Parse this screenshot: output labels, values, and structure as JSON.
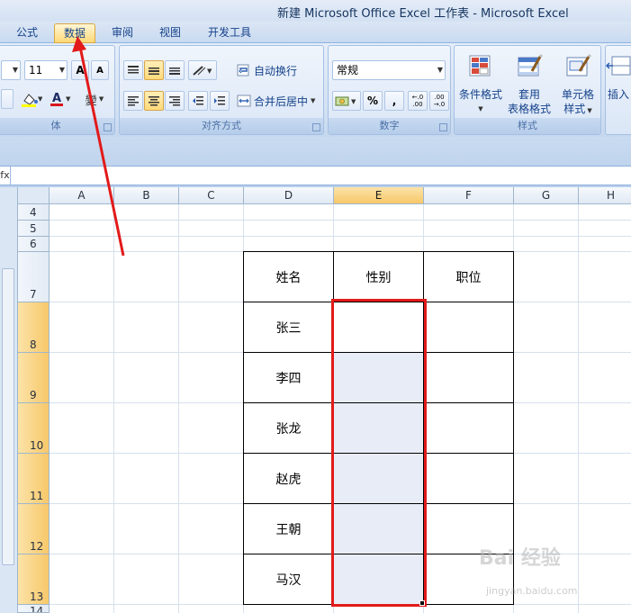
{
  "window": {
    "title": "新建 Microsoft Office Excel 工作表 - Microsoft Excel"
  },
  "tabs": [
    {
      "label": "公式",
      "active": false
    },
    {
      "label": "数据",
      "active": true
    },
    {
      "label": "审阅",
      "active": false
    },
    {
      "label": "视图",
      "active": false
    },
    {
      "label": "开发工具",
      "active": false
    }
  ],
  "ribbon": {
    "font": {
      "size": "11",
      "grow_label": "A",
      "shrink_label": "A",
      "font_color_label": "A",
      "phonetic_label": "變",
      "group_label": "体"
    },
    "alignment": {
      "wrap_text": "自动换行",
      "merge_center": "合并后居中",
      "group_label": "对齐方式"
    },
    "number": {
      "format": "常规",
      "percent": "%",
      "comma": ",",
      "dec_inc": "←.0 .00",
      "dec_dec": ".00 →.0",
      "group_label": "数字"
    },
    "styles": {
      "conditional": "条件格式",
      "table_line1": "套用",
      "table_line2": "表格格式",
      "cell_line1": "单元格",
      "cell_line2": "样式",
      "group_label": "样式"
    },
    "cells": {
      "insert": "插入"
    }
  },
  "formula_bar": {
    "fx": "fx",
    "value": ""
  },
  "sheet": {
    "columns": [
      "A",
      "B",
      "C",
      "D",
      "E",
      "F",
      "G",
      "H"
    ],
    "rows": [
      "4",
      "5",
      "6",
      "7",
      "8",
      "9",
      "10",
      "11",
      "12",
      "13",
      "14"
    ],
    "header": {
      "name": "姓名",
      "gender": "性别",
      "position": "职位"
    },
    "names": [
      "张三",
      "李四",
      "张龙",
      "赵虎",
      "王朝",
      "马汉"
    ]
  },
  "colors": {
    "accent": "#e21a1a",
    "selection_fill": "#e8ecf6",
    "header_highlight": "#f8c86a"
  },
  "watermark": {
    "main": "Bai 经验",
    "sub": "jingyan.baidu.com"
  }
}
